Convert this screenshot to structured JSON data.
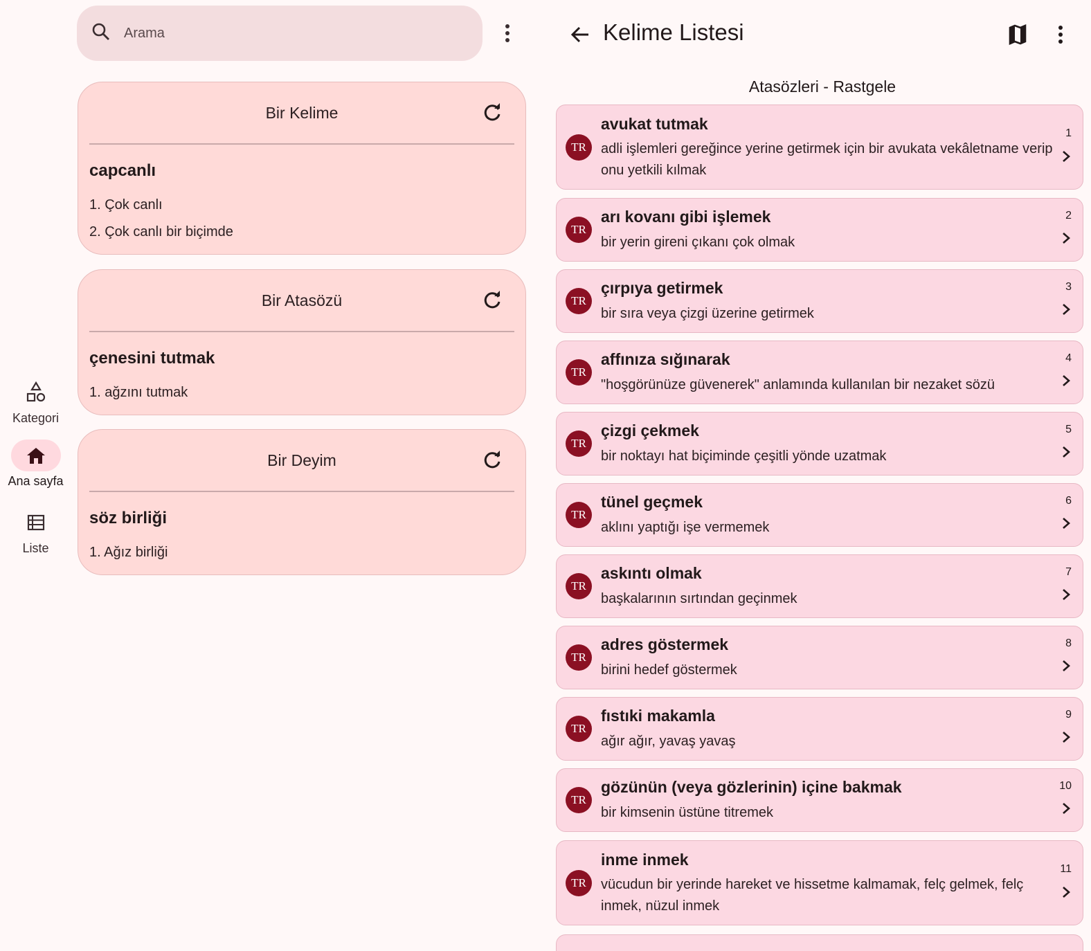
{
  "nav": {
    "items": [
      {
        "label": "Kategori",
        "icon": "category-icon"
      },
      {
        "label": "Ana sayfa",
        "icon": "home-icon"
      },
      {
        "label": "Liste",
        "icon": "list-icon"
      }
    ],
    "active": "Ana sayfa"
  },
  "search": {
    "placeholder": "Arama"
  },
  "cards": [
    {
      "title": "Bir Kelime",
      "word": "capcanlı",
      "definitions": [
        "1. Çok canlı",
        "2. Çok canlı bir biçimde"
      ]
    },
    {
      "title": "Bir Atasözü",
      "word": "çenesini tutmak",
      "definitions": [
        "1. ağzını tutmak"
      ]
    },
    {
      "title": "Bir Deyim",
      "word": "söz birliği",
      "definitions": [
        "1. Ağız birliği"
      ]
    }
  ],
  "list_page": {
    "title": "Kelime Listesi",
    "subtitle": "Atasözleri - Rastgele",
    "badge": "TR",
    "entries": [
      {
        "num": "1",
        "title": "avukat tutmak",
        "desc": "adli işlemleri gereğince yerine getirmek için bir avukata vekâletname verip onu yetkili kılmak"
      },
      {
        "num": "2",
        "title": "arı kovanı gibi işlemek",
        "desc": "bir yerin gireni çıkanı çok olmak"
      },
      {
        "num": "3",
        "title": "çırpıya getirmek",
        "desc": "bir sıra veya çizgi üzerine getirmek"
      },
      {
        "num": "4",
        "title": "affınıza sığınarak",
        "desc": "\"hoşgörünüze güvenerek\" anlamında kullanılan bir nezaket sözü"
      },
      {
        "num": "5",
        "title": "çizgi çekmek",
        "desc": "bir noktayı hat biçiminde çeşitli yönde uzatmak"
      },
      {
        "num": "6",
        "title": "tünel geçmek",
        "desc": "aklını yaptığı işe vermemek"
      },
      {
        "num": "7",
        "title": "askıntı olmak",
        "desc": "başkalarının sırtından geçinmek"
      },
      {
        "num": "8",
        "title": "adres göstermek",
        "desc": "birini hedef göstermek"
      },
      {
        "num": "9",
        "title": "fıstıki makamla",
        "desc": "ağır ağır, yavaş yavaş"
      },
      {
        "num": "10",
        "title": "gözünün (veya gözlerinin) içine bakmak",
        "desc": "bir kimsenin üstüne titremek"
      },
      {
        "num": "11",
        "title": "inme inmek",
        "desc": "vücudun bir yerinde hareket ve hissetme kalmamak, felç gelmek, felç inmek, nüzul inmek"
      }
    ]
  },
  "colors": {
    "accent": "#8b1023",
    "card": "#ffdad8",
    "entry": "#fcd8e2",
    "search": "#f3dddf",
    "active_indicator": "#ffd9df"
  }
}
